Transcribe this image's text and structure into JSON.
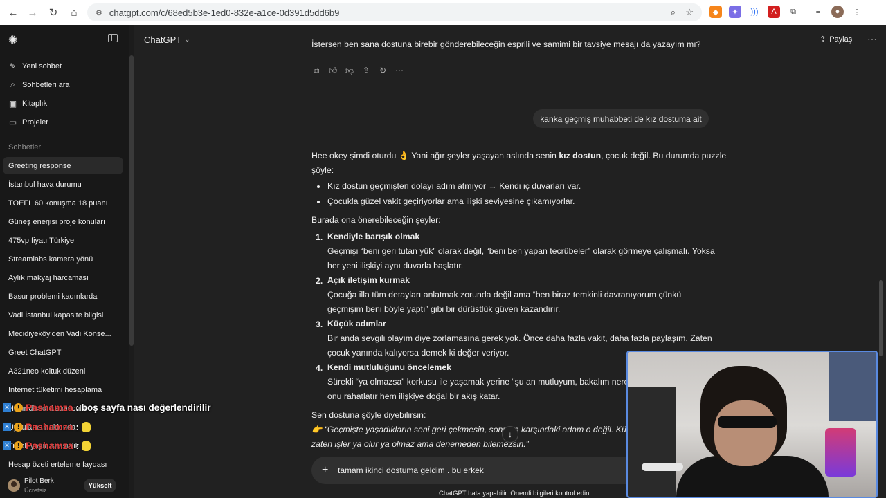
{
  "browser": {
    "url": "chatgpt.com/c/68ed5b3e-1ed0-832e-a1ce-0d391d5dd6b9"
  },
  "sidebar": {
    "actions": [
      {
        "label": "Yeni sohbet",
        "icon": "pencil-square-icon"
      },
      {
        "label": "Sohbetleri ara",
        "icon": "search-icon"
      },
      {
        "label": "Kitaplık",
        "icon": "library-icon"
      },
      {
        "label": "Projeler",
        "icon": "folder-icon"
      }
    ],
    "section_title": "Sohbetler",
    "chats": [
      "Greeting response",
      "İstanbul hava durumu",
      "TOEFL 60 konuşma 18 puanı",
      "Güneş enerjisi proje konuları",
      "475vp fiyatı Türkiye",
      "Streamlabs kamera yönü",
      "Aylık makyaj harcaması",
      "Basur problemi kadınlarda",
      "Vadi İstanbul kapasite bilgisi",
      "Mecidiyeköy'den Vadi Konse...",
      "Greet ChatGPT",
      "A321neo koltuk düzeni",
      "Internet tüketimi hesaplama",
      "Hazır discord sunucuları",
      "Uygulama hakkında",
      "Tiktok yayın sessizlik",
      "Hesap özeti erteleme faydası"
    ],
    "user": {
      "name": "Pilot Berk",
      "plan": "Ücretsiz"
    },
    "upgrade_label": "Yükselt"
  },
  "header": {
    "model": "ChatGPT",
    "share_label": "Paylaş"
  },
  "conversation": {
    "prev_tail": "İstersen ben sana dostuna birebir gönderebileceğin esprili ve samimi bir tavsiye mesajı da yazayım mı?",
    "user_message": "kanka geçmiş muhabbeti de kız dostuma ait",
    "reply": {
      "intro_a": "Hee okey şimdi oturdu 👌 Yani ağır şeyler yaşayan aslında senin ",
      "intro_bold": "kız dostun",
      "intro_b": ", çocuk değil. Bu durumda puzzle",
      "intro_c": "şöyle:",
      "bullets": [
        "Kız dostun geçmişten dolayı adım atmıyor → Kendi iç duvarları var.",
        "Çocukla güzel vakit geçiriyorlar ama ilişki seviyesine çıkamıyorlar."
      ],
      "suggest_intro": "Burada ona önerebileceğin şeyler:",
      "items": [
        {
          "num": "1.",
          "title": "Kendiyle barışık olmak",
          "l1": "Geçmişi “beni geri tutan yük” olarak değil, “beni ben yapan tecrübeler” olarak görmeye çalışmalı. Yoksa",
          "l2": "her yeni ilişkiyi aynı duvarla başlatır."
        },
        {
          "num": "2.",
          "title": "Açık iletişim kurmak",
          "l1": "Çocuğa illa tüm detayları anlatmak zorunda değil ama “ben biraz temkinli davranıyorum çünkü",
          "l2": "geçmişim beni böyle yaptı” gibi bir dürüstlük güven kazandırır."
        },
        {
          "num": "3.",
          "title": "Küçük adımlar",
          "l1": "Bir anda sevgili olayım diye zorlamasına gerek yok. Önce daha fazla vakit, daha fazla paylaşım. Zaten",
          "l2": "çocuk yanında kalıyorsa demek ki değer veriyor."
        },
        {
          "num": "4.",
          "title": "Kendi mutluluğunu öncelemek",
          "l1": "Sürekli “ya olmazsa” korkusu ile yaşamak yerine “şu an mutluyum, bakalım nereye",
          "l2": "onu rahatlatır hem ilişkiye doğal bir akış katar."
        }
      ],
      "closing": "Sen dostuna şöyle diyebilirsin:",
      "quote_1": "👉 “Geçmişte yaşadıkların seni geri çekmesin, sonuçta karşındaki adam o değil. Küçük k",
      "quote_2": "zaten işler ya olur ya olmaz ama denemeden bilemezsin.”"
    }
  },
  "composer": {
    "text": "tamam ikinci dostuma geldim . bu erkek"
  },
  "disclaimer": "ChatGPT hata yapabilir. Önemli bilgileri kontrol edin.",
  "stream_overlay": [
    {
      "name": "Pashamza",
      "message": ": boş sayfa nası değerlendirilir"
    },
    {
      "name": "Pashamza",
      "message": ":"
    },
    {
      "name": "Pashamza",
      "message": ":"
    }
  ]
}
